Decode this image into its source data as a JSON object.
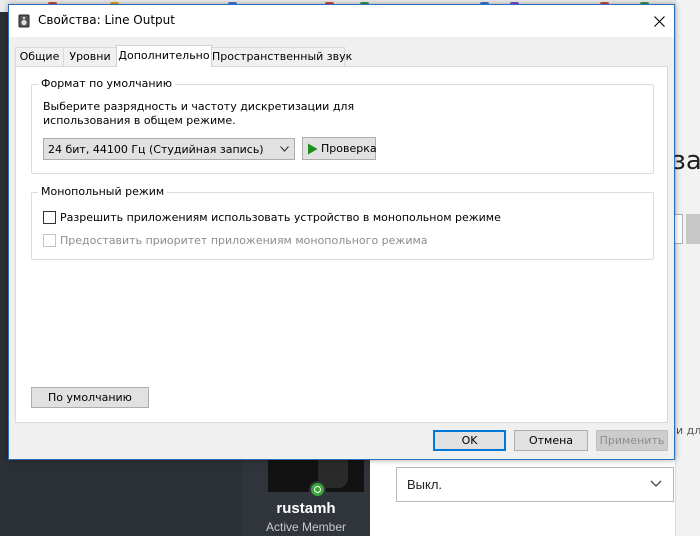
{
  "window": {
    "title": "Свойства: Line Output",
    "icons": {
      "app": "speaker-icon",
      "close": "close-icon"
    }
  },
  "tabs": [
    {
      "label": "Общие",
      "active": false
    },
    {
      "label": "Уровни",
      "active": false
    },
    {
      "label": "Дополнительно",
      "active": true
    },
    {
      "label": "Пространственный звук",
      "active": false
    }
  ],
  "default_format": {
    "legend": "Формат по умолчанию",
    "description_line1": "Выберите разрядность и частоту дискретизации для",
    "description_line2": "использования в общем режиме.",
    "selected_format": "24 бит, 44100 Гц (Студийная запись)",
    "test_button": "Проверка",
    "test_icon": "play-icon"
  },
  "exclusive_mode": {
    "legend": "Монопольный режим",
    "allow_exclusive": {
      "label": "Разрешить приложениям использовать устройство в монопольном режиме",
      "checked": false,
      "enabled": true
    },
    "priority_exclusive": {
      "label": "Предоставить приоритет приложениям монопольного режима",
      "checked": false,
      "enabled": false
    }
  },
  "restore_defaults_button": "По умолчанию",
  "footer": {
    "ok": "OK",
    "cancel": "Отмена",
    "apply": "Применить"
  },
  "background": {
    "heading_fragment": "за",
    "side_text_fragment": "и для",
    "username": "rustamh",
    "user_title": "Active Member",
    "select_value": "Выкл.",
    "colors": {
      "online": "#3aa63a",
      "accent": "#0078d7",
      "dark_bg": "#2b2f36"
    }
  }
}
